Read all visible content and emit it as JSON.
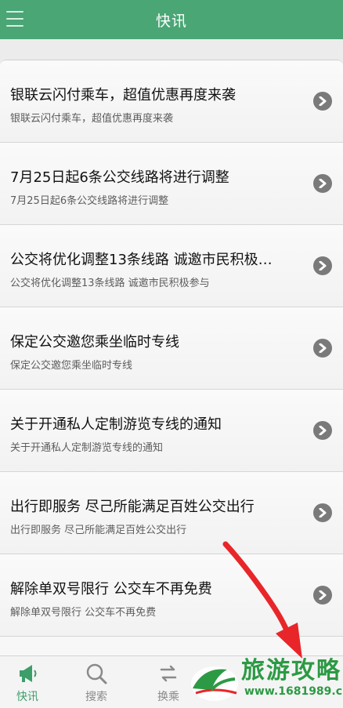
{
  "header": {
    "title": "快讯"
  },
  "news": [
    {
      "title": "银联云闪付乘车，超值优惠再度来袭",
      "subtitle": "银联云闪付乘车，超值优惠再度来袭"
    },
    {
      "title": "7月25日起6条公交线路将进行调整",
      "subtitle": "7月25日起6条公交线路将进行调整"
    },
    {
      "title": "公交将优化调整13条线路 诚邀市民积极…",
      "subtitle": "公交将优化调整13条线路 诚邀市民积极参与"
    },
    {
      "title": "保定公交邀您乘坐临时专线",
      "subtitle": "保定公交邀您乘坐临时专线"
    },
    {
      "title": "关于开通私人定制游览专线的通知",
      "subtitle": "关于开通私人定制游览专线的通知"
    },
    {
      "title": "出行即服务 尽己所能满足百姓公交出行",
      "subtitle": "出行即服务 尽己所能满足百姓公交出行"
    },
    {
      "title": "解除单双号限行 公交车不再免费",
      "subtitle": "解除单双号限行 公交车不再免费"
    }
  ],
  "tabs": [
    {
      "label": "快讯",
      "icon": "megaphone-icon",
      "active": true
    },
    {
      "label": "搜索",
      "icon": "search-icon",
      "active": false
    },
    {
      "label": "换乘",
      "icon": "transfer-icon",
      "active": false
    }
  ],
  "watermark": {
    "title": "旅游攻略",
    "url": "www.1681989.cn"
  },
  "colors": {
    "header": "#4aa675",
    "active_tab": "#3d9e6a",
    "arrow": "#e8262a",
    "watermark": "#2c9a44"
  }
}
